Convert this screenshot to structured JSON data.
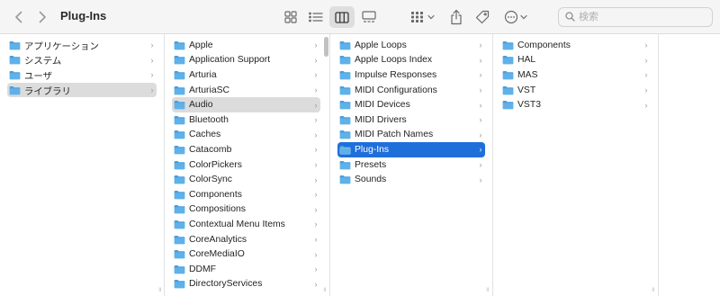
{
  "window": {
    "title": "Plug-Ins"
  },
  "search": {
    "placeholder": "検索"
  },
  "columns": {
    "locations": [
      {
        "label": "アプリケーション",
        "selected": false
      },
      {
        "label": "システム",
        "selected": false
      },
      {
        "label": "ユーザ",
        "selected": false
      },
      {
        "label": "ライブラリ",
        "selected": true
      }
    ],
    "library": [
      {
        "label": "Apple"
      },
      {
        "label": "Application Support"
      },
      {
        "label": "Arturia"
      },
      {
        "label": "ArturiaSC"
      },
      {
        "label": "Audio",
        "selected": true
      },
      {
        "label": "Bluetooth"
      },
      {
        "label": "Caches"
      },
      {
        "label": "Catacomb"
      },
      {
        "label": "ColorPickers"
      },
      {
        "label": "ColorSync"
      },
      {
        "label": "Components"
      },
      {
        "label": "Compositions"
      },
      {
        "label": "Contextual Menu Items"
      },
      {
        "label": "CoreAnalytics"
      },
      {
        "label": "CoreMediaIO"
      },
      {
        "label": "DDMF"
      },
      {
        "label": "DirectoryServices"
      }
    ],
    "audio": [
      {
        "label": "Apple Loops"
      },
      {
        "label": "Apple Loops Index"
      },
      {
        "label": "Impulse Responses"
      },
      {
        "label": "MIDI Configurations"
      },
      {
        "label": "MIDI Devices"
      },
      {
        "label": "MIDI Drivers"
      },
      {
        "label": "MIDI Patch Names"
      },
      {
        "label": "Plug-Ins",
        "selected": true
      },
      {
        "label": "Presets"
      },
      {
        "label": "Sounds"
      }
    ],
    "plugins": [
      {
        "label": "Components"
      },
      {
        "label": "HAL"
      },
      {
        "label": "MAS"
      },
      {
        "label": "VST"
      },
      {
        "label": "VST3"
      }
    ]
  },
  "colors": {
    "folder": "#5fb1ea",
    "folder_tab": "#4a9fdc",
    "selection_blue": "#1f6fdb",
    "selection_gray": "#dcdcdc"
  },
  "icons": {
    "back": "chevron-left-icon",
    "forward": "chevron-right-icon",
    "icon_view": "grid-icon",
    "list_view": "list-icon",
    "column_view": "columns-icon",
    "gallery_view": "gallery-icon",
    "group": "group-grid-icon",
    "share": "share-icon",
    "tags": "tag-icon",
    "actions": "ellipsis-icon",
    "search": "search-icon"
  }
}
